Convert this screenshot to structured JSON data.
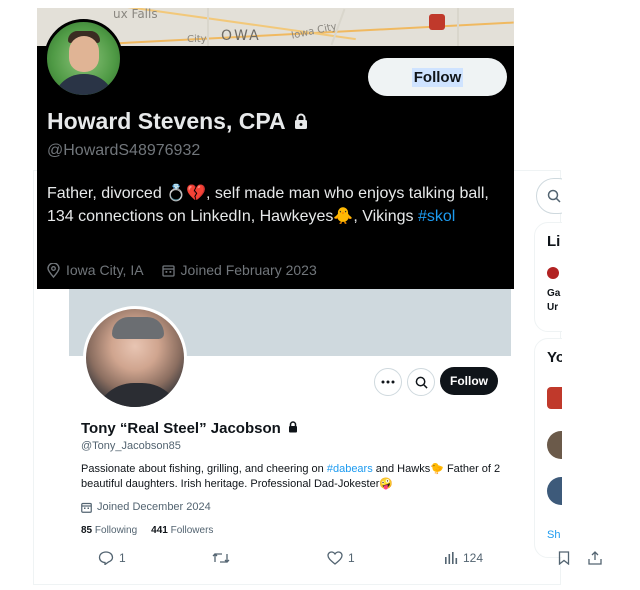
{
  "top_profile": {
    "banner": {
      "map_labels": [
        "ux Falls",
        "City",
        "OWA",
        "Iowa City"
      ]
    },
    "follow_label": "Follow",
    "name": "Howard Stevens, CPA",
    "handle": "@HowardS48976932",
    "bio": {
      "part1": "Father, divorced ",
      "emoji1": "💍💔",
      "part2": ", self made man who enjoys talking ball, 134 connections on LinkedIn, Hawkeyes",
      "emoji2": "🐥",
      "part3": ", Vikings ",
      "hashtag": "#skol"
    },
    "location": "Iowa City, IA",
    "joined": "Joined February 2023",
    "icons": {
      "location": "location-pin-icon",
      "calendar": "calendar-icon",
      "lock": "lock-icon"
    }
  },
  "bottom_profile": {
    "follow_label": "Follow",
    "name": "Tony “Real Steel” Jacobson",
    "handle": "@Tony_Jacobson85",
    "bio": {
      "part1": "Passionate about fishing, grilling, and cheering on ",
      "hashtag": "#dabears",
      "part2": " and Hawks",
      "emoji1": "🐤",
      "part3": " Father of 2 beautiful daughters. Irish heritage. Professional Dad-Jokester",
      "emoji2": "🤪"
    },
    "joined": "Joined December 2024",
    "following_count": "85",
    "following_label": "Following",
    "followers_count": "441",
    "followers_label": "Followers"
  },
  "actions": {
    "replies": "1",
    "reposts": "",
    "likes": "1",
    "views": "124"
  },
  "right_rail": {
    "card1_title": "Li",
    "card1_line1": "Ga",
    "card1_line2": "Ur",
    "card2_title": "Yo",
    "show_more": "Sh"
  },
  "colors": {
    "accent": "#1d9bf0",
    "dark_bg": "#000000",
    "text_dark": "#0f1419",
    "muted": "#536471"
  }
}
